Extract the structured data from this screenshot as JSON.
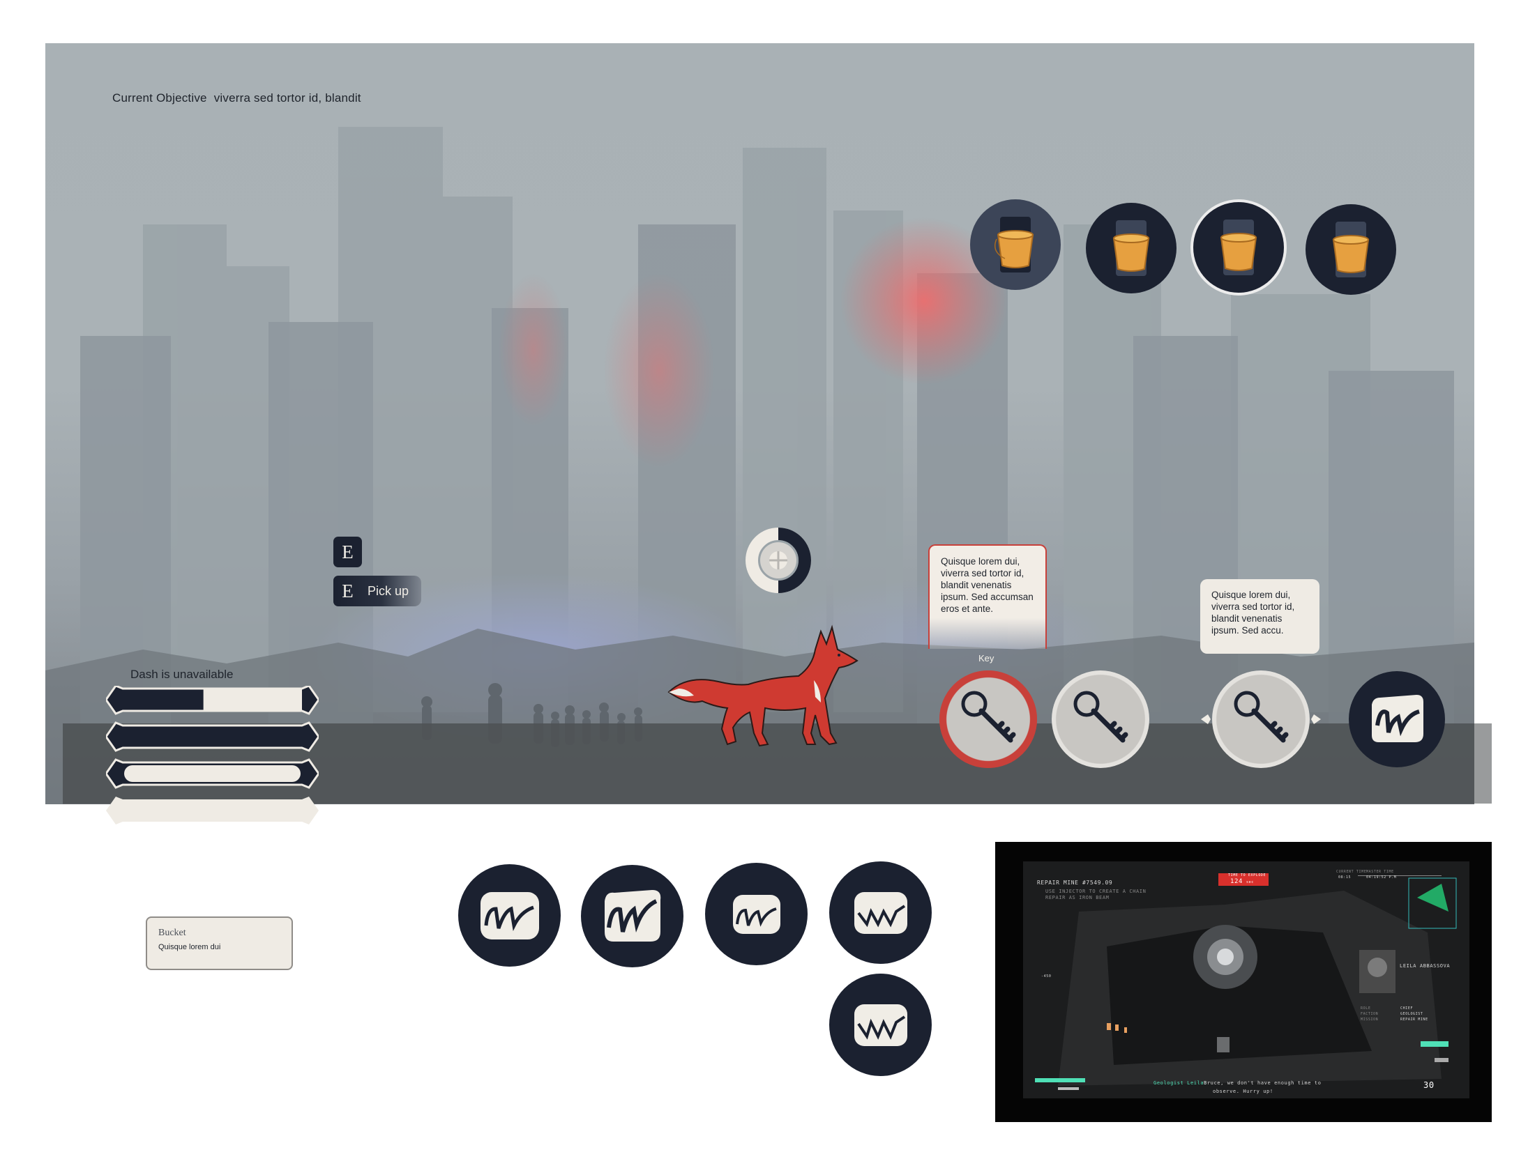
{
  "hud": {
    "objective_label": "Current Objective",
    "objective_text": "viverra sed tortor id, blandit",
    "interact_key": "E",
    "pickup_key": "E",
    "pickup_label": "Pick up",
    "dash_status": "Dash is unavailable",
    "dash_levels": [
      0.45,
      1.0,
      0.0,
      0.0
    ]
  },
  "inventory": {
    "bucket_slots": [
      {
        "icon": "bucket-icon",
        "state": "default"
      },
      {
        "icon": "bucket-icon",
        "state": "alt"
      },
      {
        "icon": "bucket-icon",
        "state": "selected"
      },
      {
        "icon": "bucket-icon",
        "state": "default"
      }
    ],
    "key_label": "Key",
    "key_slots": [
      {
        "icon": "key-icon",
        "state": "active"
      },
      {
        "icon": "key-icon",
        "state": "default"
      },
      {
        "icon": "key-icon",
        "state": "hover"
      }
    ]
  },
  "tooltips": {
    "primary": "Quisque lorem dui, viverra sed tortor id, blandit venenatis ipsum. Sed accumsan eros et ante.",
    "secondary": "Quisque lorem dui, viverra sed tortor id, blandit venenatis ipsum. Sed accu."
  },
  "card": {
    "title": "Bucket",
    "description": "Quisque lorem dui"
  },
  "reference": {
    "mission_title": "REPAIR MINE #7549.09",
    "mission_sub1": "USE INJECTOR TO CREATE A CHAIN",
    "mission_sub2": "REPAIR AS IRON BEAM",
    "timer_label": "TIME TO EXPLODE",
    "timer_value": "124",
    "timer_unit": "sec",
    "current_time_label": "CURRENT TIME",
    "master_time_label": "MASTER TIME",
    "current_time": "08:15",
    "master_time": "04:19:52 P.M",
    "character_name": "LEILA ABBASSOVA",
    "role_label": "ROLE",
    "role_value": "CHIEF",
    "faction_label": "FACTION",
    "faction_value": "GEOLOGIST",
    "mission_label": "MISSION",
    "mission_value": "REPAIR MINE",
    "depth_value": "-450",
    "dialogue_speaker": "Geologist Leila:",
    "dialogue_line1": "Bruce, we don't have enough time to",
    "dialogue_line2": "observe. Hurry up!",
    "ammo": "30"
  },
  "colors": {
    "dark_navy": "#1b2130",
    "cream": "#f0ede6",
    "accent_red": "#c8403a",
    "bucket_orange": "#e6a040",
    "fox_red": "#cf3a31",
    "teal": "#4fe0b6"
  }
}
